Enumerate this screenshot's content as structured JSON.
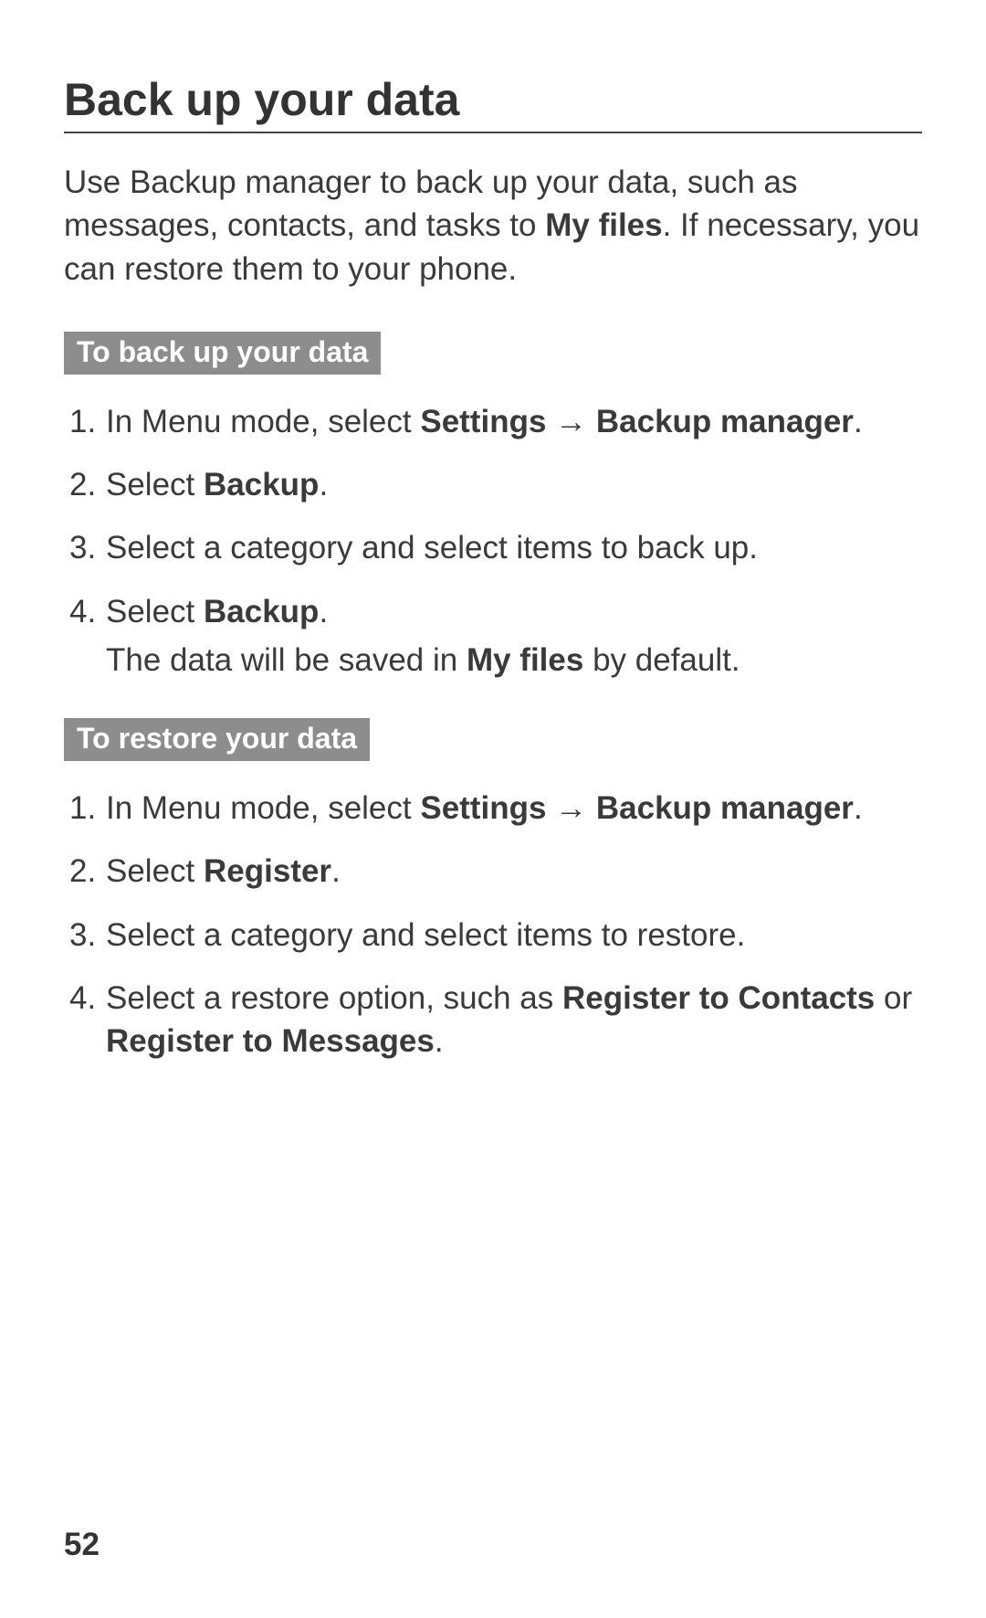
{
  "title": "Back up your data",
  "intro": {
    "pre": "Use Backup manager to back up your data, such as messages, contacts, and tasks to ",
    "bold1": "My files",
    "post": ". If necessary, you can restore them to your phone."
  },
  "section1": {
    "label": "To back up your data",
    "steps": [
      {
        "num": "1.",
        "parts": [
          "In Menu mode, select ",
          "Settings",
          " → ",
          "Backup manager",
          "."
        ]
      },
      {
        "num": "2.",
        "parts": [
          "Select ",
          "Backup",
          "."
        ]
      },
      {
        "num": "3.",
        "parts": [
          "Select a category and select items to back up."
        ]
      },
      {
        "num": "4.",
        "parts": [
          "Select ",
          "Backup",
          "."
        ],
        "note_pre": "The data will be saved in ",
        "note_bold": "My files",
        "note_post": " by default."
      }
    ]
  },
  "section2": {
    "label": "To restore your data",
    "steps": [
      {
        "num": "1.",
        "parts": [
          "In Menu mode, select ",
          "Settings",
          " → ",
          "Backup manager",
          "."
        ]
      },
      {
        "num": "2.",
        "parts": [
          "Select ",
          "Register",
          "."
        ]
      },
      {
        "num": "3.",
        "parts": [
          "Select a category and select items to restore."
        ]
      },
      {
        "num": "4.",
        "parts": [
          "Select a restore option, such as ",
          "Register to Contacts",
          " or ",
          "Register to Messages",
          "."
        ]
      }
    ]
  },
  "page_number": "52"
}
